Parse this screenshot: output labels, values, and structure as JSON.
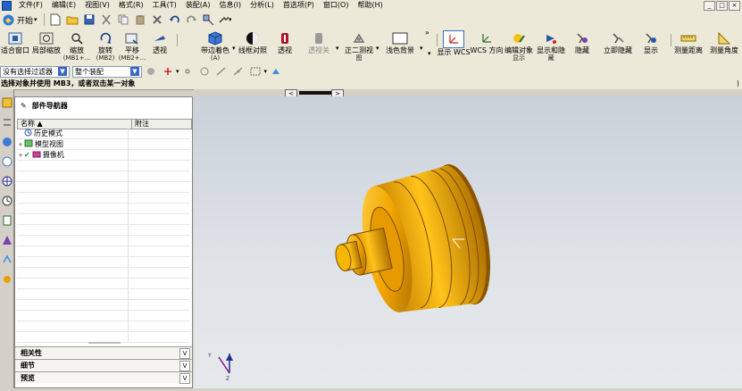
{
  "menubar": {
    "items": [
      "文件(F)",
      "编辑(E)",
      "视图(V)",
      "格式(R)",
      "工具(T)",
      "装配(A)",
      "信息(I)",
      "分析(L)",
      "首选项(P)",
      "窗口(O)",
      "帮助(H)"
    ],
    "window_buttons": [
      "_",
      "□",
      "×"
    ]
  },
  "toolbar": {
    "start_label": "开始",
    "icons": [
      "new-file",
      "open-folder",
      "save",
      "cut",
      "copy",
      "paste",
      "delete",
      "undo",
      "redo",
      "snap",
      "tool"
    ]
  },
  "view_toolbar": {
    "buttons": [
      {
        "label": "适合窗口",
        "sub": ""
      },
      {
        "label": "局部缩放",
        "sub": ""
      },
      {
        "label": "缩放",
        "sub": "(MB1+..."
      },
      {
        "label": "旋转",
        "sub": "(MB2)"
      },
      {
        "label": "平移",
        "sub": "(MB2+..."
      },
      {
        "label": "透视",
        "sub": ""
      },
      {
        "label": "带边着色",
        "sub": "(A)"
      },
      {
        "label": "线框对照",
        "sub": ""
      },
      {
        "label": "透视",
        "sub": ""
      },
      {
        "label": "透视关",
        "sub": ""
      },
      {
        "label": "正二测视",
        "sub": "图"
      },
      {
        "label": "浅色背景",
        "sub": ""
      },
      {
        "label": "显示 WCS",
        "sub": ""
      },
      {
        "label": "WCS 方向",
        "sub": ""
      },
      {
        "label": "编辑对象",
        "sub": "显示"
      },
      {
        "label": "显示和隐",
        "sub": "藏"
      },
      {
        "label": "隐藏",
        "sub": ""
      },
      {
        "label": "立即隐藏",
        "sub": ""
      },
      {
        "label": "显示",
        "sub": ""
      },
      {
        "label": "测量距离",
        "sub": ""
      },
      {
        "label": "测量角度",
        "sub": ""
      }
    ]
  },
  "filter_bar": {
    "type_filter": "没有选择过滤器",
    "scope": "整个装配"
  },
  "prompt": {
    "text": "选择对象并使用 MB3，或者双击某一对象"
  },
  "navigator": {
    "title": "部件导航器",
    "columns": [
      "名称 ▲",
      "附注"
    ],
    "rows": [
      {
        "label": "历史模式",
        "expander": "",
        "icon": "history-icon"
      },
      {
        "label": "模型视图",
        "expander": "+",
        "icon": "model-views-icon"
      },
      {
        "label": "摄像机",
        "expander": "+",
        "icon": "camera-icon"
      }
    ],
    "panels": [
      "相关性",
      "细节",
      "预览"
    ]
  },
  "colors": {
    "part_gold": "#f2a500",
    "part_shadow": "#a86a00",
    "viewport_bg": "#d4dadf",
    "accent": "#3b6cb7"
  }
}
